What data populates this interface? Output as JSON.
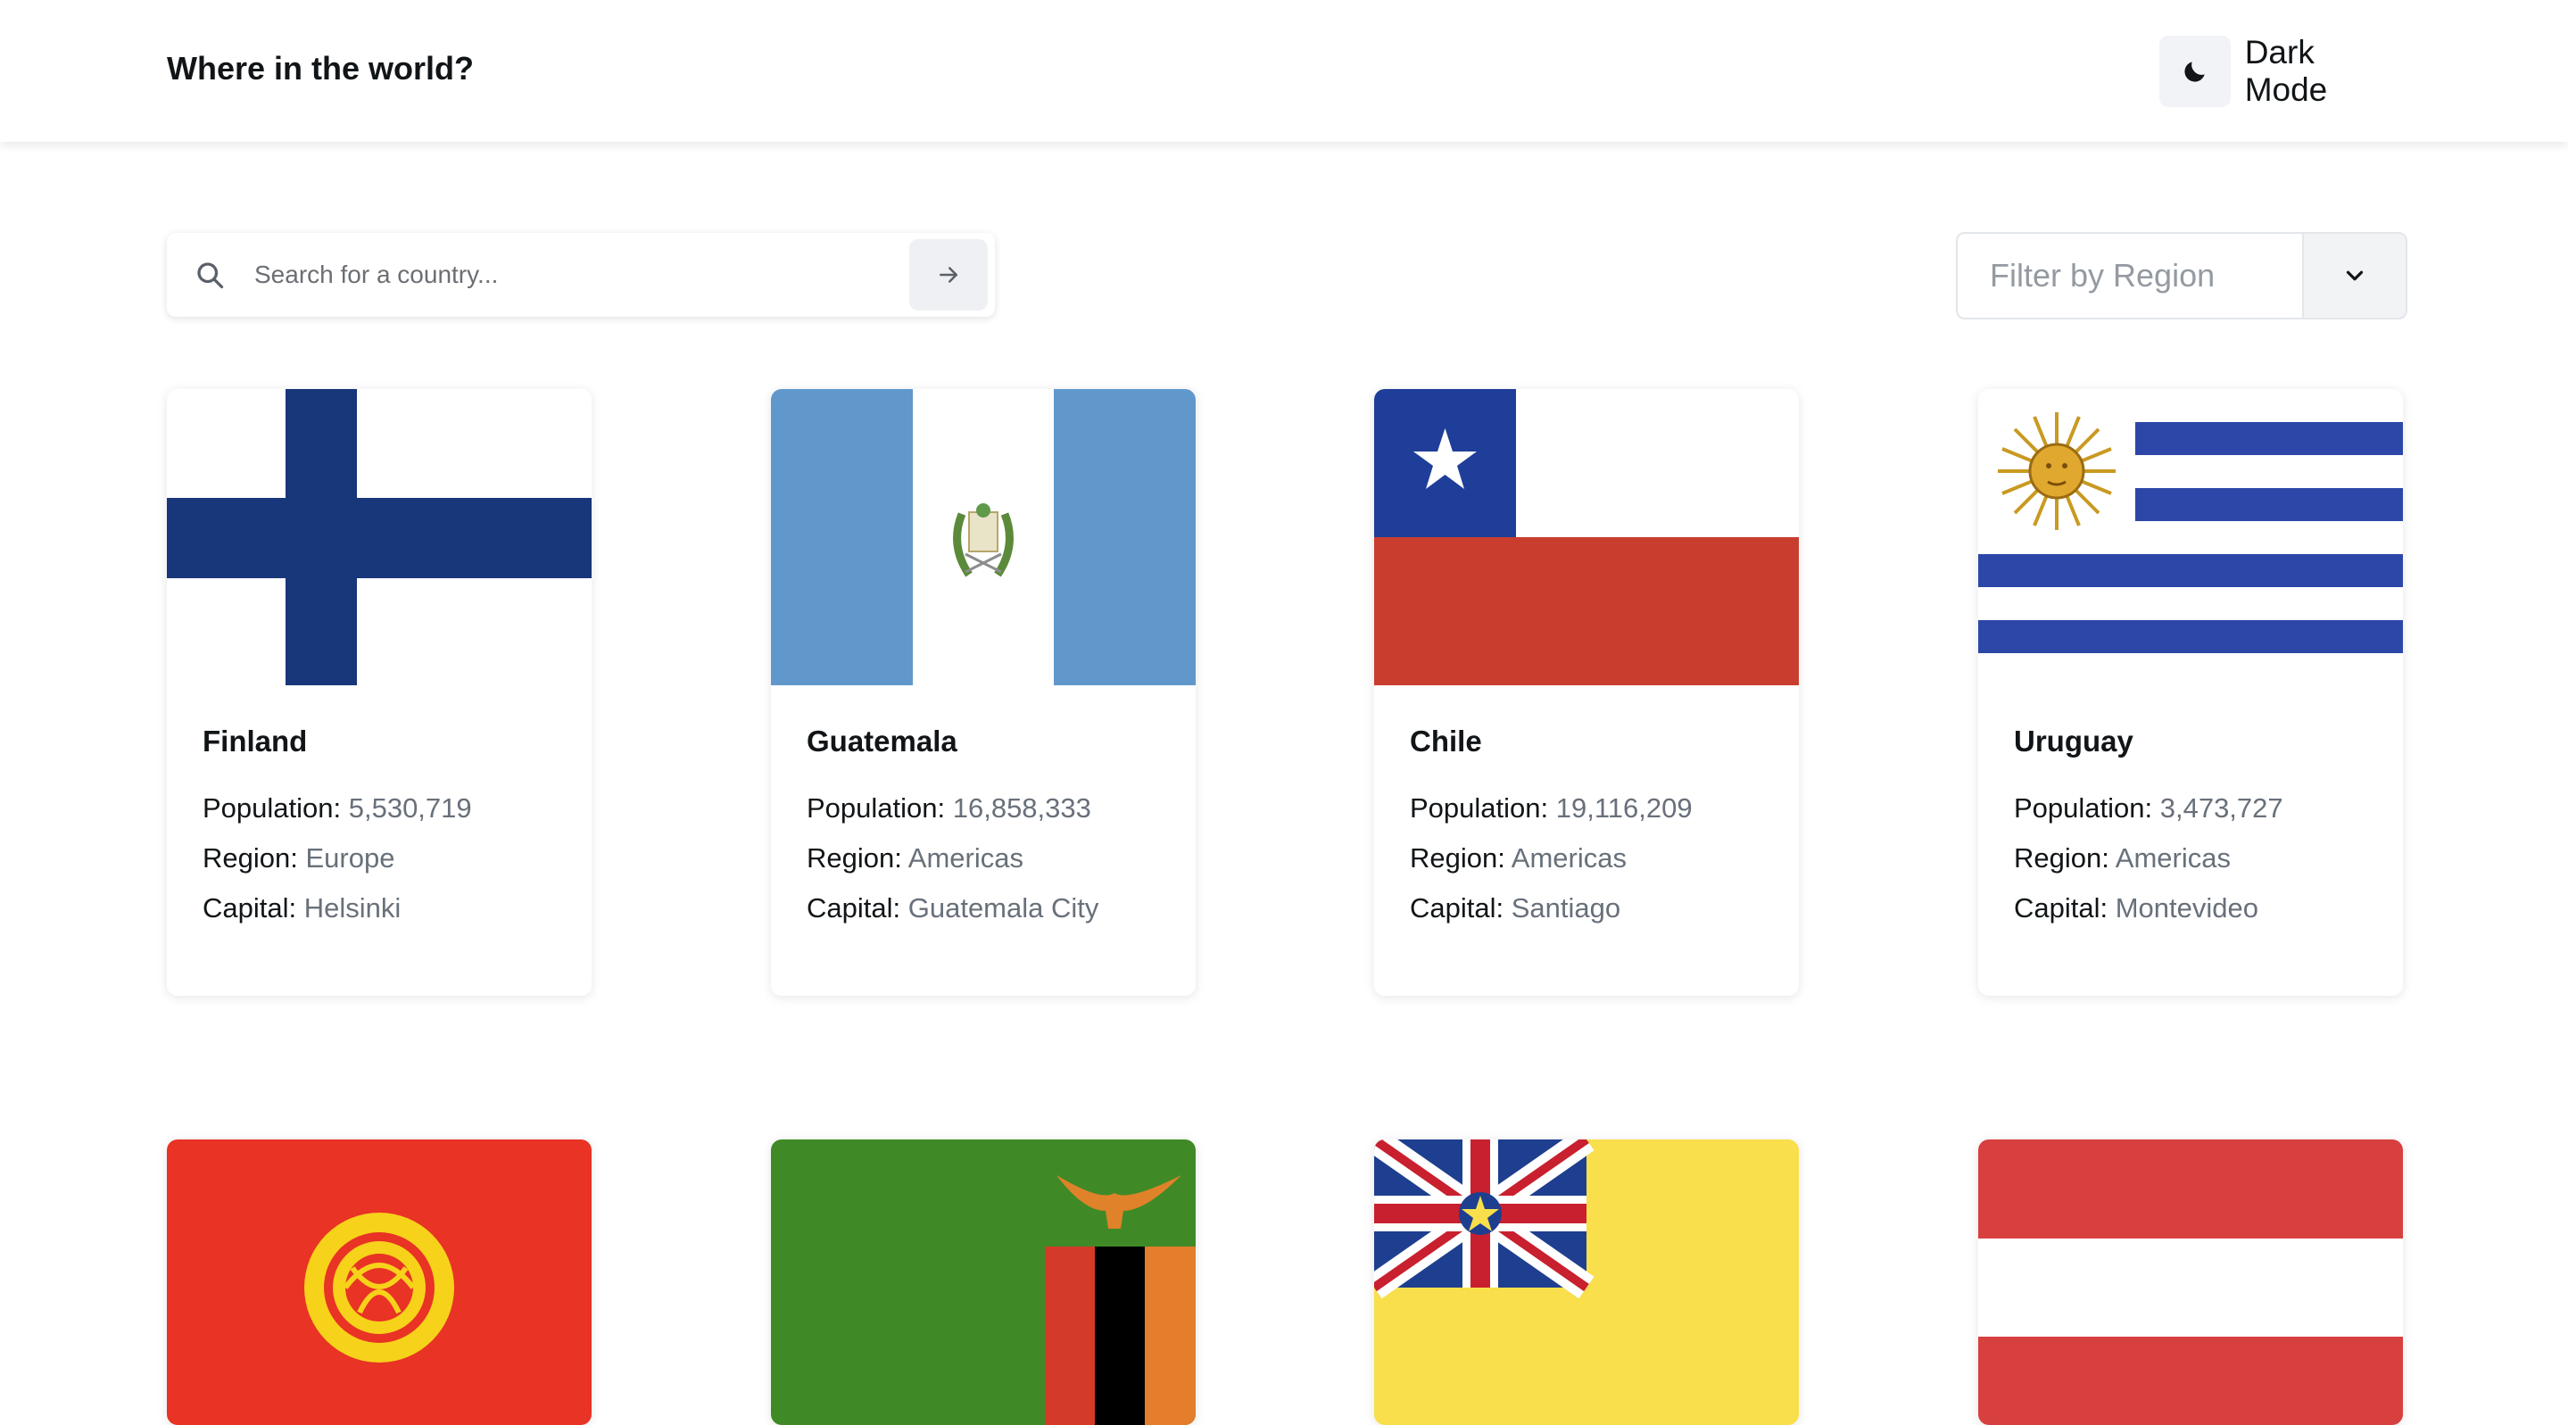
{
  "header": {
    "title": "Where in the world?",
    "dark_mode_label": "Dark Mode"
  },
  "search": {
    "placeholder": "Search for a country..."
  },
  "filter": {
    "label": "Filter by Region"
  },
  "labels": {
    "population": "Population: ",
    "region": "Region: ",
    "capital": "Capital: "
  },
  "countries": [
    {
      "name": "Finland",
      "population": "5,530,719",
      "region": "Europe",
      "capital": "Helsinki"
    },
    {
      "name": "Guatemala",
      "population": "16,858,333",
      "region": "Americas",
      "capital": "Guatemala City"
    },
    {
      "name": "Chile",
      "population": "19,116,209",
      "region": "Americas",
      "capital": "Santiago"
    },
    {
      "name": "Uruguay",
      "population": "3,473,727",
      "region": "Americas",
      "capital": "Montevideo"
    }
  ],
  "flags": {
    "row1": [
      "finland-flag",
      "guatemala-flag",
      "chile-flag",
      "uruguay-flag"
    ],
    "row2": [
      "kyrgyzstan-flag",
      "zambia-flag",
      "niue-flag",
      "austria-flag"
    ]
  },
  "colors": {
    "text": "#111517",
    "muted": "#68707a",
    "surface": "#ffffff"
  }
}
